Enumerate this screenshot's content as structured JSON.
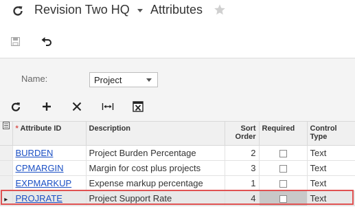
{
  "header": {
    "company": "Revision Two HQ",
    "screen_title": "Attributes"
  },
  "form": {
    "name_label": "Name:",
    "name_value": "Project"
  },
  "grid": {
    "columns": {
      "attribute_id": "Attribute ID",
      "description": "Description",
      "sort_order": "Sort Order",
      "required": "Required",
      "control_type": "Control Type"
    },
    "required_marker": "*",
    "rows": [
      {
        "id": "BURDEN",
        "description": "Project Burden Percentage",
        "sort": "2",
        "required": false,
        "control": "Text"
      },
      {
        "id": "CPMARGIN",
        "description": "Margin for cost plus projects",
        "sort": "3",
        "required": false,
        "control": "Text"
      },
      {
        "id": "EXPMARKUP",
        "description": "Expense markup percentage",
        "sort": "1",
        "required": false,
        "control": "Text"
      },
      {
        "id": "PROJRATE",
        "description": "Project Support Rate",
        "sort": "4",
        "required": false,
        "control": "Text"
      }
    ]
  },
  "colors": {
    "link": "#1a4fc4",
    "highlight": "#e05252",
    "panel_bg": "#f4f4f4"
  }
}
